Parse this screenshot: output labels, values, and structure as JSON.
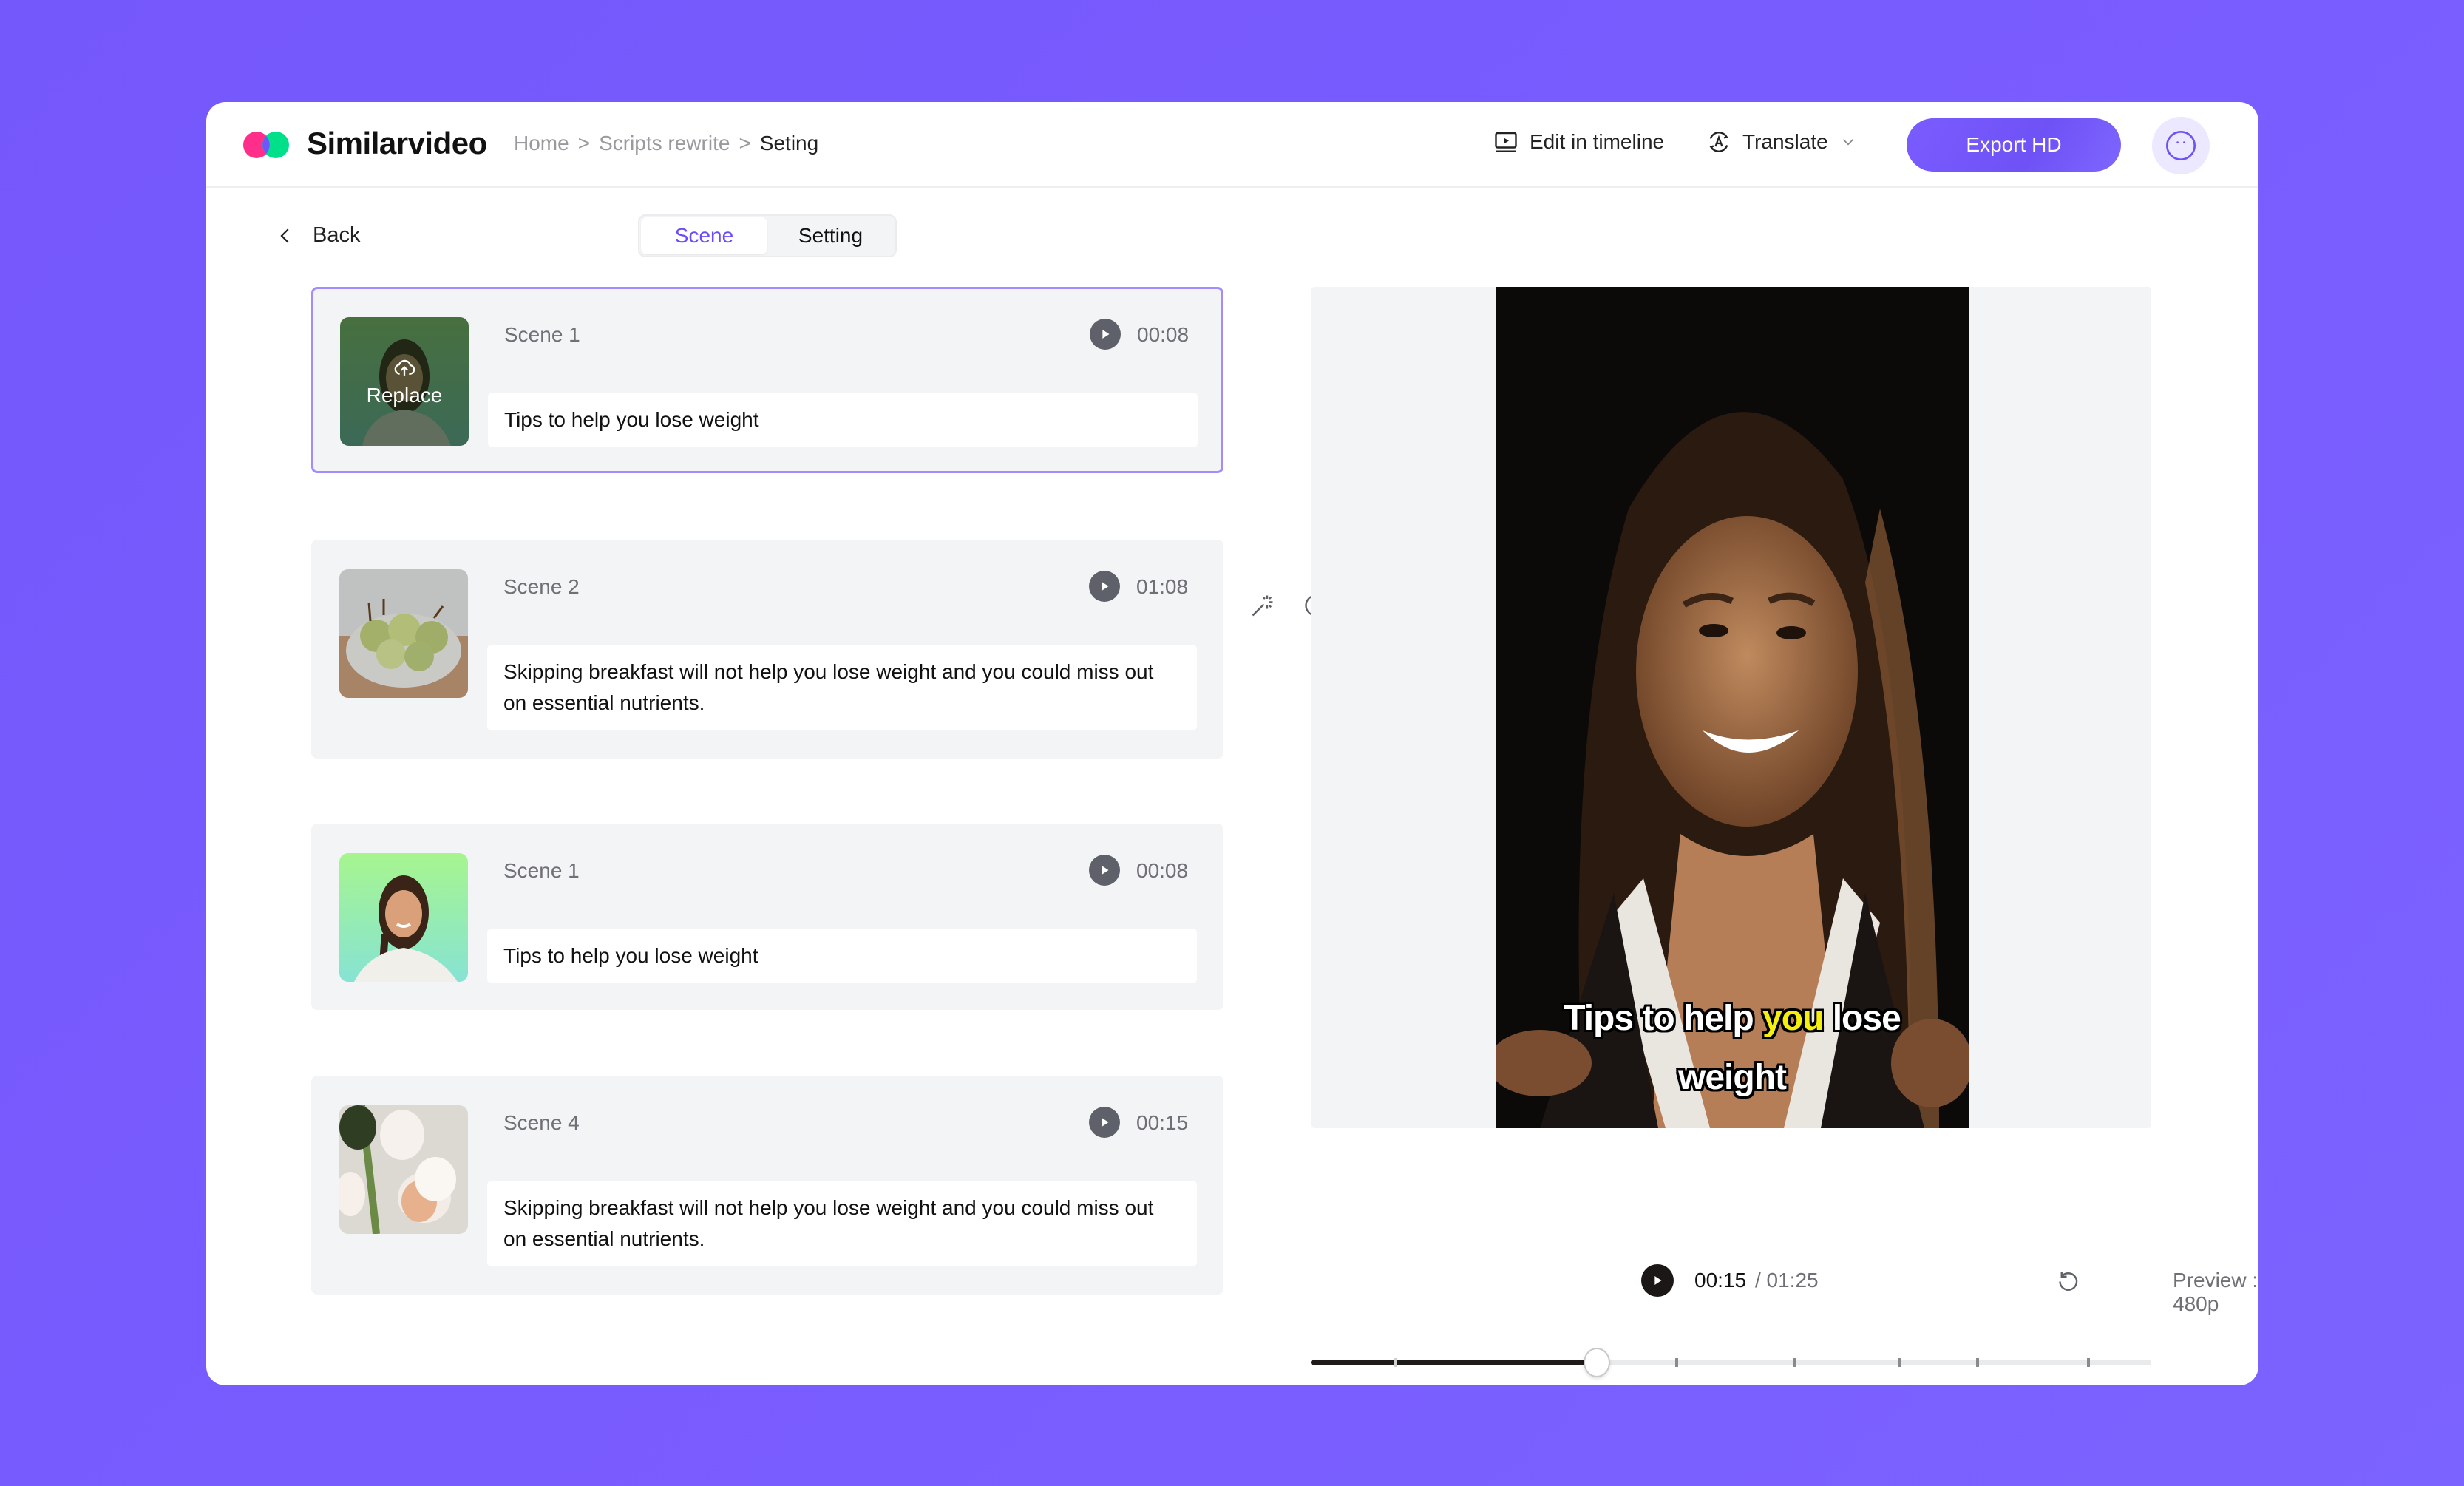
{
  "app": {
    "brand": "Similarvideo",
    "logo_colors": {
      "left": "#ff2e8a",
      "right": "#00e08a",
      "overlap": "#7055ff"
    }
  },
  "breadcrumb": {
    "items": [
      "Home",
      "Scripts rewrite",
      "Seting"
    ],
    "separator": ">"
  },
  "header": {
    "edit_timeline_label": "Edit in timeline",
    "translate_label": "Translate",
    "export_label": "Export HD",
    "accent": "#7055ff"
  },
  "subbar": {
    "back_label": "Back",
    "tabs": [
      {
        "label": "Scene",
        "active": true
      },
      {
        "label": "Setting",
        "active": false
      }
    ]
  },
  "scenes": [
    {
      "name": "Scene 1",
      "duration": "00:08",
      "text": "Tips to help you lose weight",
      "thumbnail": "woman-portrait-green",
      "selected": true,
      "overlay_label": "Replace"
    },
    {
      "name": "Scene 2",
      "duration": "01:08",
      "text": "Skipping breakfast will not help you lose weight and you could miss out on essential nutrients.",
      "thumbnail": "pears-in-bowl",
      "selected": false
    },
    {
      "name": "Scene 1",
      "duration": "00:08",
      "text": "Tips to help you lose weight",
      "thumbnail": "woman-portrait-green",
      "selected": false
    },
    {
      "name": "Scene 4",
      "duration": "00:15",
      "text": "Skipping breakfast will not help you lose weight and you could miss out on essential nutrients.",
      "thumbnail": "white-flowers-cup",
      "selected": false
    }
  ],
  "scene_toolbar": {
    "icons": [
      "ai-rewrite-icon",
      "add-scene-icon",
      "magic-wand-icon",
      "move-down-icon",
      "move-up-icon",
      "more-icon"
    ]
  },
  "preview": {
    "caption_before": "Tips to help ",
    "caption_highlight": "you",
    "caption_after": " lose weight",
    "highlight_color": "#f5ef10",
    "current_time": "00:15",
    "total_time": "/ 01:25",
    "quality_label": "Preview : 480p",
    "progress_fraction": 0.34,
    "scene_markers": [
      0.1,
      0.435,
      0.575,
      0.7,
      0.793,
      0.925
    ]
  }
}
